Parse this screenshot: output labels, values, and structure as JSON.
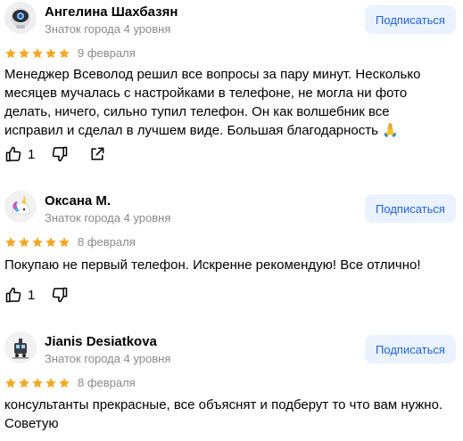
{
  "colors": {
    "star": "#f5a623",
    "subscribe_bg": "#eaf2ff",
    "subscribe_text": "#1d64d8",
    "muted": "#8a8a8a"
  },
  "reviews": [
    {
      "author": "Ангелина Шахбазян",
      "badge": "Знаток города 4 уровня",
      "subscribe_label": "Подписаться",
      "rating": 5,
      "date": "9 февраля",
      "text": "Менеджер Всеволод решил все вопросы за пару минут. Несколько месяцев мучалась с настройками в телефоне, не могла ни фото делать, ничего, сильно тупил телефон. Он как волшебник все исправил и сделал в лучшем виде. Большая благодарность 🙏",
      "likes": "1",
      "avatar_icon": "robot-avatar-icon"
    },
    {
      "author": "Оксана М.",
      "badge": "Знаток города 4 уровня",
      "subscribe_label": "Подписаться",
      "rating": 5,
      "date": "8 февраля",
      "text": "Покупаю не первый телефон. Искренне рекомендую! Все отлично!",
      "likes": "1",
      "avatar_icon": "unicorn-avatar-icon"
    },
    {
      "author": "Jianis Desiatkova",
      "badge": "Знаток города 4 уровня",
      "subscribe_label": "Подписаться",
      "rating": 5,
      "date": "8 февраля",
      "text": "консультанты прекрасные, все объяснят и подберут то что вам нужно. Советую",
      "avatar_icon": "train-avatar-icon"
    }
  ]
}
